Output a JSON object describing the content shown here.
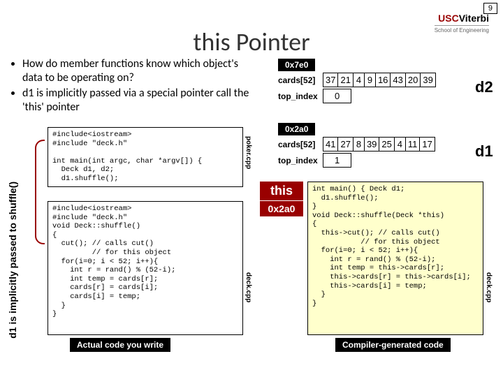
{
  "pageNumber": "9",
  "logo": {
    "left": "USC",
    "right": "Viterbi",
    "sub": "School of Engineering"
  },
  "title": "this Pointer",
  "bullets": [
    "How do member functions know which object's data to be operating on?",
    "d1 is implicitly passed via a special pointer call the 'this' pointer"
  ],
  "mem1": {
    "addr": "0x7e0",
    "cardsLabel": "cards[52]",
    "cards": [
      "37",
      "21",
      "4",
      "9",
      "16",
      "43",
      "20",
      "39"
    ],
    "topIndexLabel": "top_index",
    "topIndex": "0",
    "objName": "d2"
  },
  "mem2": {
    "addr": "0x2a0",
    "cardsLabel": "cards[52]",
    "cards": [
      "41",
      "27",
      "8",
      "39",
      "25",
      "4",
      "11",
      "17"
    ],
    "topIndexLabel": "top_index",
    "topIndex": "1",
    "objName": "d1"
  },
  "sideText": "d1 is implicitly\npassed to shuffle()",
  "fileTab1": "poker.cpp",
  "fileTab2": "deck.cpp",
  "fileTab3": "deck.cpp",
  "code1": "#include<iostream>\n#include \"deck.h\"\n\nint main(int argc, char *argv[]) {\n  Deck d1, d2;\n  d1.shuffle();",
  "code2": "#include<iostream>\n#include \"deck.h\"\nvoid Deck::shuffle()\n{\n  cut(); // calls cut()\n         // for this object\n  for(i=0; i < 52; i++){\n    int r = rand() % (52-i);\n    int temp = cards[r];\n    cards[r] = cards[i];\n    cards[i] = temp;\n  }\n}",
  "code3": "int main() { Deck d1;\n  d1.shuffle();\n}\nvoid Deck::shuffle(Deck *this)\n{\n  this->cut(); // calls cut()\n           // for this object\n  for(i=0; i < 52; i++){\n    int r = rand() % (52-i);\n    int temp = this->cards[r];\n    this->cards[r] = this->cards[i];\n    this->cards[i] = temp;\n  }\n}",
  "thisLabel": "this",
  "thisAddr": "0x2a0",
  "actualLabel": "Actual code you write",
  "compilerLabel": "Compiler-generated code"
}
